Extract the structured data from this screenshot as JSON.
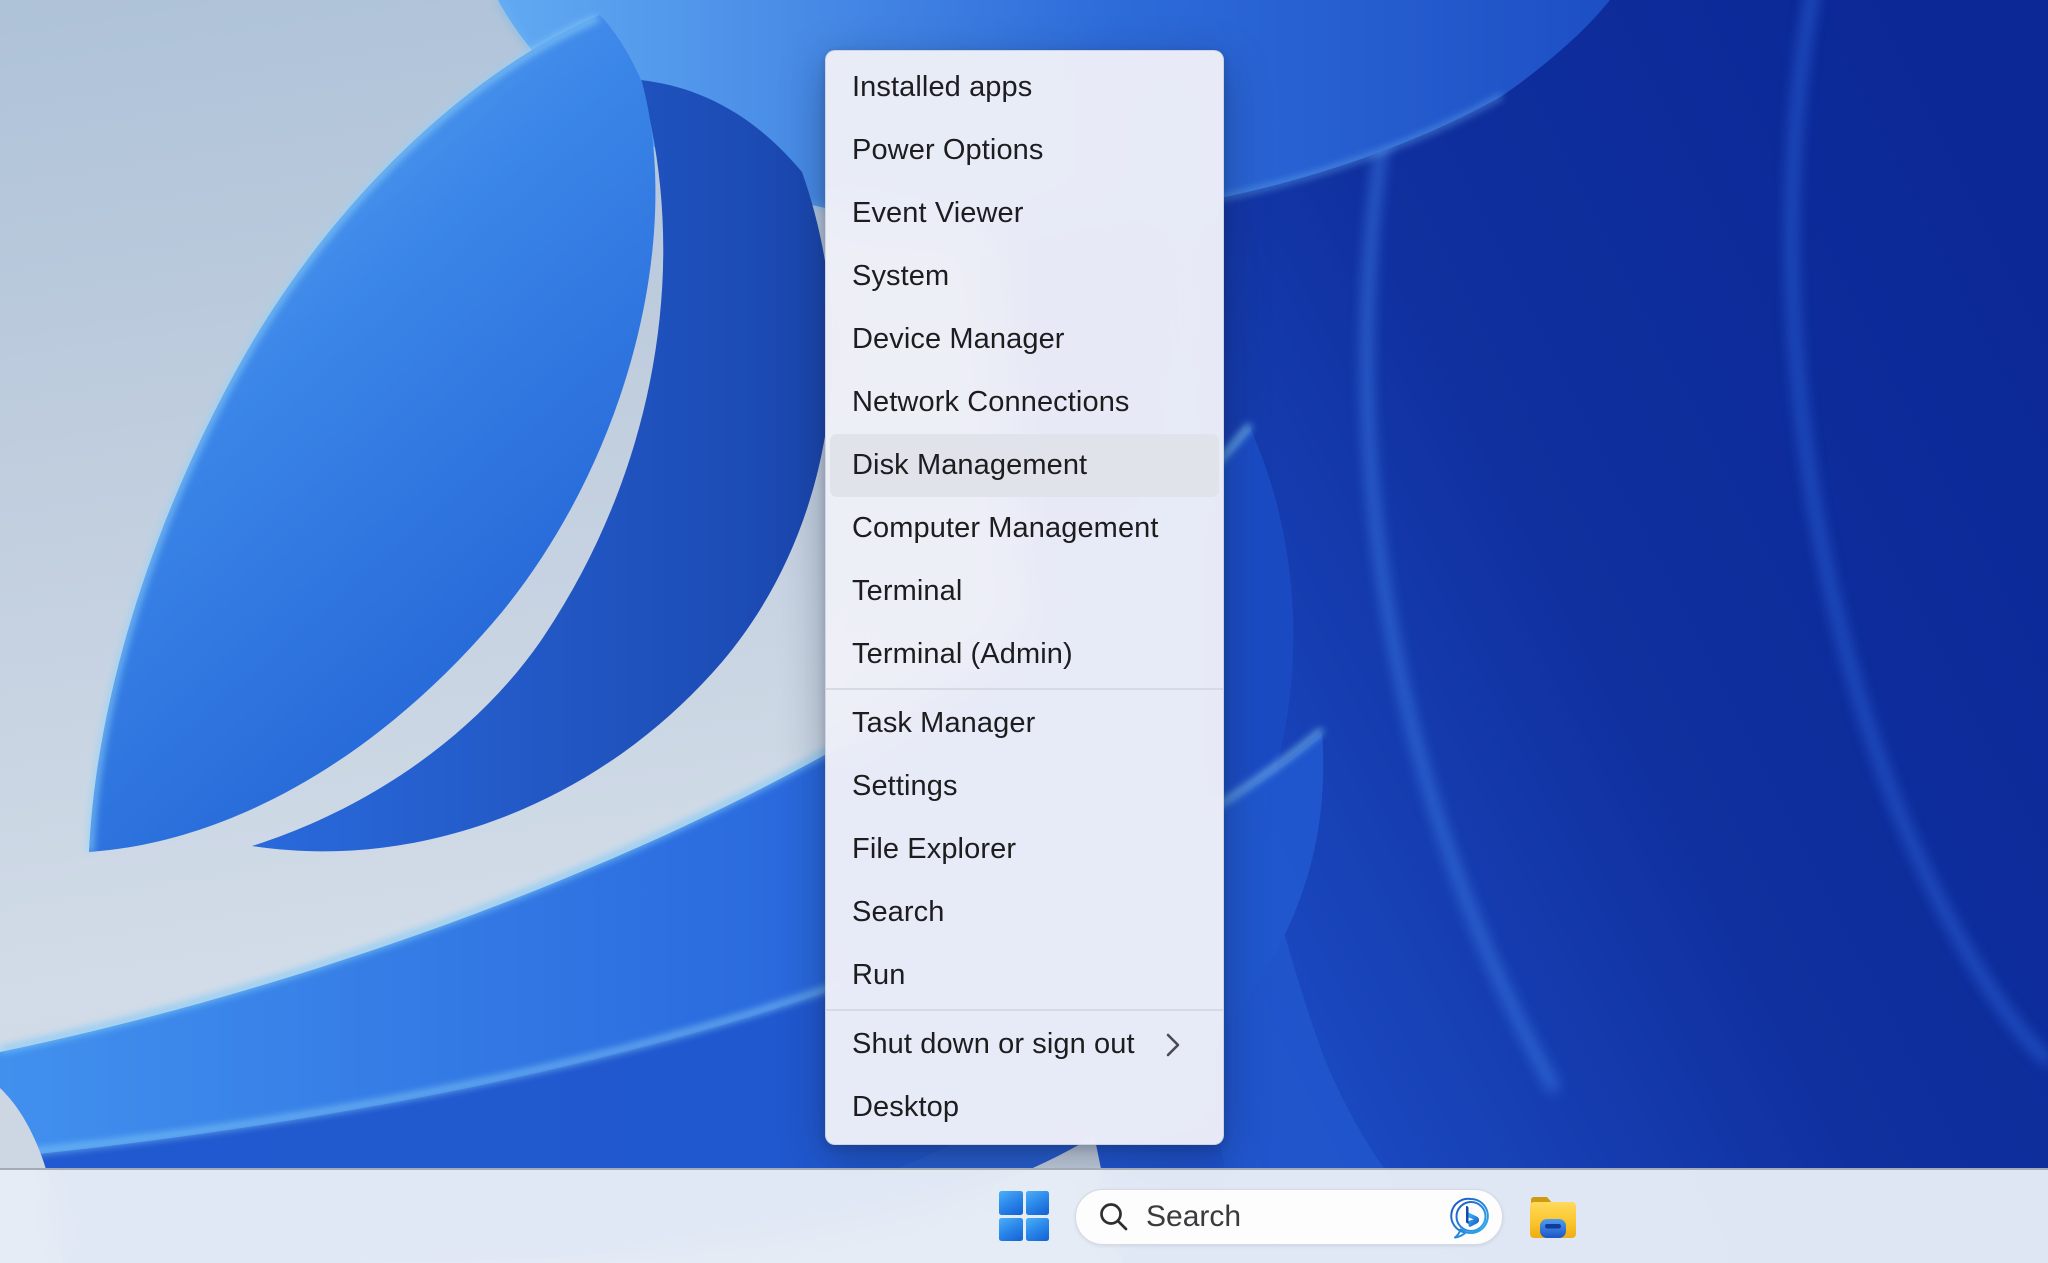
{
  "wallpaper": {
    "name": "windows-11-bloom",
    "colors": {
      "light_base": "#c2cfdf",
      "petal_blue": "#2f7ee8",
      "petal_light_rim": "#8fd2fa",
      "deep_blue": "#0e2c9e"
    }
  },
  "context_menu": {
    "highlighted_item": "Disk Management",
    "items": [
      {
        "label": "Installed apps"
      },
      {
        "label": "Power Options"
      },
      {
        "label": "Event Viewer"
      },
      {
        "label": "System"
      },
      {
        "label": "Device Manager"
      },
      {
        "label": "Network Connections"
      },
      {
        "label": "Disk Management",
        "state": "highlighted"
      },
      {
        "label": "Computer Management"
      },
      {
        "label": "Terminal"
      },
      {
        "label": "Terminal (Admin)"
      },
      {
        "label": "Task Manager"
      },
      {
        "label": "Settings"
      },
      {
        "label": "File Explorer"
      },
      {
        "label": "Search"
      },
      {
        "label": "Run"
      },
      {
        "label": "Shut down or sign out",
        "has_submenu": true,
        "submenu_indicator": "chevron-right-icon"
      },
      {
        "label": "Desktop"
      }
    ],
    "separators_after_indices": [
      9,
      14
    ]
  },
  "taskbar": {
    "start_button": {
      "icon": "windows-logo-icon"
    },
    "search_box": {
      "placeholder": "Search",
      "leading_icon": "search-icon",
      "trailing_icon": "bing-copilot-icon"
    },
    "file_explorer_button": {
      "icon": "file-explorer-folder-icon"
    }
  },
  "colors": {
    "menu_background": "#eef0f7",
    "menu_highlight": "#e1e3ea",
    "menu_text": "#1d1d20",
    "menu_separator": "#d7dae2",
    "taskbar_background": "#e6ecf6",
    "search_pill_background": "#fdfdfe",
    "windows_logo_blue": "#1d6fe0",
    "folder_yellow": "#fac62c",
    "folder_pocket_blue": "#2e6fdc",
    "bing_blue": "#2565dd"
  }
}
